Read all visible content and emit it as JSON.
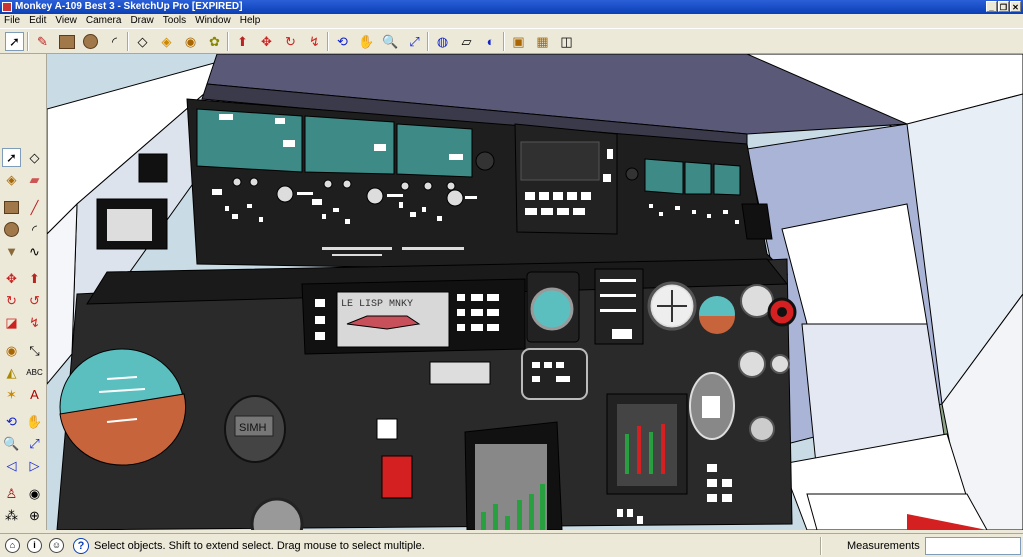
{
  "window": {
    "title": "Monkey A-109 Best 3 - SketchUp Pro [EXPIRED]",
    "minimize": "_",
    "restore": "❐",
    "close": "✕"
  },
  "menu": [
    "File",
    "Edit",
    "View",
    "Camera",
    "Draw",
    "Tools",
    "Window",
    "Help"
  ],
  "toolbar_icons": [
    "select-arrow",
    "pencil",
    "rectangle",
    "circle",
    "arc",
    "eraser",
    "paint-bucket",
    "tape-measure",
    "paint",
    "push-pull",
    "move",
    "rotate",
    "follow-me",
    "orbit",
    "pan",
    "zoom",
    "zoom-extents",
    "get-models",
    "share-model",
    "3d-warehouse",
    "components",
    "styles",
    "add-location"
  ],
  "status": {
    "message": "Select objects. Shift to extend select. Drag mouse to select multiple.",
    "measurements_label": "Measurements",
    "measurements_value": ""
  },
  "cockpit": {
    "display_text": "LE LISP MNKY",
    "gauge_text": "SIMH"
  },
  "colors": {
    "teal_screen": "#3d8a86",
    "horizon_sky": "#5bbfc0",
    "horizon_ground": "#c8643c",
    "panel_black": "#1e1e1e",
    "sky": "#c9dbe5",
    "ground": "#8fa487",
    "warning_red": "#d42020"
  }
}
